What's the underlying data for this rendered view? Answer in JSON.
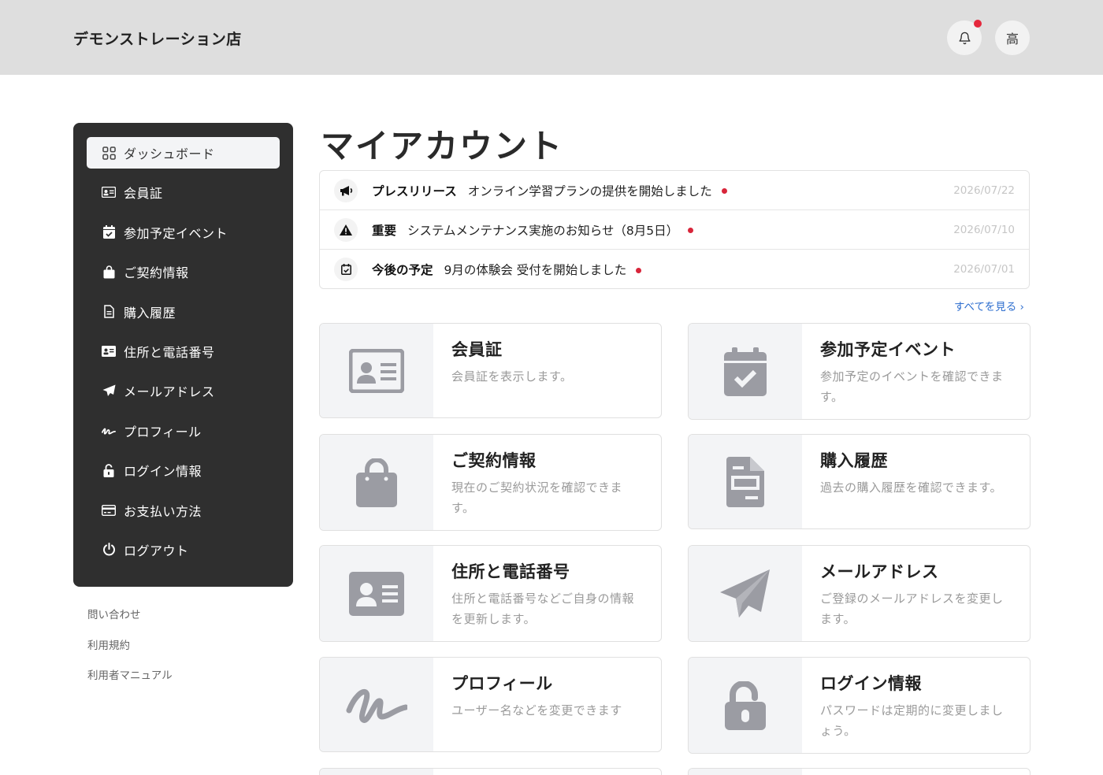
{
  "header": {
    "store_name": "デモンストレーション店",
    "avatar_initial": "高",
    "has_notification": true
  },
  "sidebar": {
    "items": [
      {
        "label": "ダッシュボード",
        "icon": "dashboard-grid-icon",
        "active": true
      },
      {
        "label": "会員証",
        "icon": "id-card-icon"
      },
      {
        "label": "参加予定イベント",
        "icon": "calendar-check-icon"
      },
      {
        "label": "ご契約情報",
        "icon": "shopping-bag-icon"
      },
      {
        "label": "購入履歴",
        "icon": "receipt-icon"
      },
      {
        "label": "住所と電話番号",
        "icon": "address-card-icon"
      },
      {
        "label": "メールアドレス",
        "icon": "paper-plane-icon"
      },
      {
        "label": "プロフィール",
        "icon": "signature-icon"
      },
      {
        "label": "ログイン情報",
        "icon": "unlock-icon"
      },
      {
        "label": "お支払い方法",
        "icon": "credit-card-icon"
      },
      {
        "label": "ログアウト",
        "icon": "power-icon"
      }
    ],
    "links": [
      "問い合わせ",
      "利用規約",
      "利用者マニュアル"
    ]
  },
  "main": {
    "title": "マイアカウント",
    "news": [
      {
        "category": "プレスリリース",
        "text": "オンライン学習プランの提供を開始しました",
        "date": "2026/07/22",
        "icon": "megaphone-icon",
        "unread": true
      },
      {
        "category": "重要",
        "text": "システムメンテナンス実施のお知らせ（8月5日）",
        "date": "2026/07/10",
        "icon": "warning-icon",
        "unread": true
      },
      {
        "category": "今後の予定",
        "text": "9月の体験会 受付を開始しました",
        "date": "2026/07/01",
        "icon": "calendar-check-icon",
        "unread": true
      }
    ],
    "see_all": "すべてを見る ›",
    "cards": [
      {
        "title": "会員証",
        "desc": "会員証を表示します。",
        "icon": "id-card-icon"
      },
      {
        "title": "参加予定イベント",
        "desc": "参加予定のイベントを確認できます。",
        "icon": "calendar-check-icon"
      },
      {
        "title": "ご契約情報",
        "desc": "現在のご契約状況を確認できます。",
        "icon": "shopping-bag-icon"
      },
      {
        "title": "購入履歴",
        "desc": "過去の購入履歴を確認できます。",
        "icon": "receipt-icon"
      },
      {
        "title": "住所と電話番号",
        "desc": "住所と電話番号などご自身の情報を更新します。",
        "icon": "address-card-icon"
      },
      {
        "title": "メールアドレス",
        "desc": "ご登録のメールアドレスを変更します。",
        "icon": "paper-plane-icon"
      },
      {
        "title": "プロフィール",
        "desc": "ユーザー名などを変更できます",
        "icon": "signature-icon"
      },
      {
        "title": "ログイン情報",
        "desc": "パスワードは定期的に変更しましょう。",
        "icon": "unlock-icon"
      }
    ]
  },
  "colors": {
    "header_bg": "#dedede",
    "sidebar_bg": "#2f2f2f",
    "notification": "#e5283c",
    "unread_dot": "#d8253a",
    "link": "#2f6fcf",
    "card_icon": "#9b9ca3"
  }
}
